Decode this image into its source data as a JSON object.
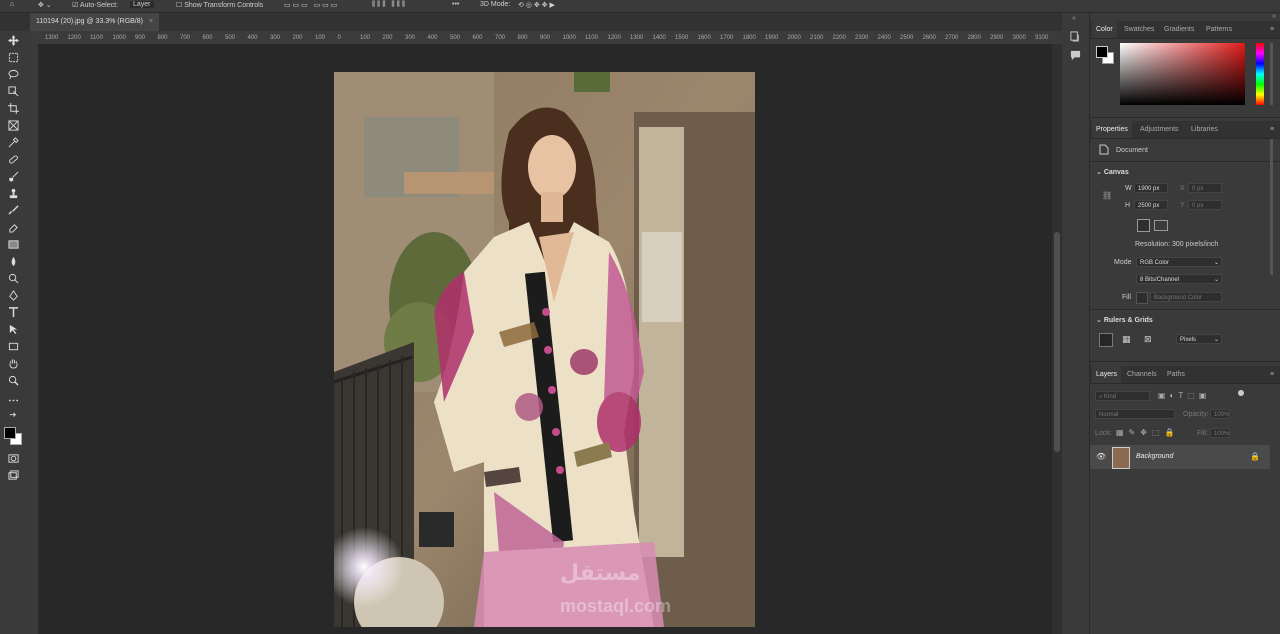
{
  "options_bar": {
    "auto_select_label": "Auto-Select:",
    "auto_select_target": "Layer",
    "transform_control_label": "Show Transform Controls",
    "mode_3d_label": "3D Mode:"
  },
  "document_tab": {
    "title": "110194 (20).jpg @ 33.3% (RGB/8)",
    "close": "×"
  },
  "ruler": {
    "ticks": [
      "1300",
      "1200",
      "1100",
      "1000",
      "900",
      "800",
      "700",
      "600",
      "500",
      "400",
      "300",
      "200",
      "100",
      "0",
      "100",
      "200",
      "300",
      "400",
      "500",
      "600",
      "700",
      "800",
      "900",
      "1000",
      "1100",
      "1200",
      "1300",
      "1400",
      "1500",
      "1600",
      "1700",
      "1800",
      "1900",
      "2000",
      "2100",
      "2200",
      "2300",
      "2400",
      "2500",
      "2600",
      "2700",
      "2800",
      "2900",
      "3000",
      "3100"
    ]
  },
  "watermark": {
    "line1": "مستقل",
    "line2": "mostaql.com"
  },
  "color_panel": {
    "tabs": [
      "Color",
      "Swatches",
      "Gradients",
      "Patterns"
    ]
  },
  "properties_panel": {
    "tabs": [
      "Properties",
      "Adjustments",
      "Libraries"
    ],
    "doc_label": "Document",
    "canvas_section": "Canvas",
    "w_label": "W",
    "w_value": "1900 px",
    "h_label": "H",
    "h_value": "2500 px",
    "x_label": "X",
    "x_value": "0 px",
    "y_label": "Y",
    "y_value": "0 px",
    "resolution": "Resolution: 300 pixels/inch",
    "mode_label": "Mode",
    "mode_value": "RGB Color",
    "depth_value": "8 Bits/Channel",
    "fill_label": "Fill",
    "fill_value": "Background Color",
    "rulers_section": "Rulers & Grids",
    "units_value": "Pixels"
  },
  "layers_panel": {
    "tabs": [
      "Layers",
      "Channels",
      "Paths"
    ],
    "kind_placeholder": "Kind",
    "blend_mode": "Normal",
    "opacity_label": "Opacity:",
    "opacity_value": "100%",
    "lock_label": "Lock:",
    "fill_label": "Fill:",
    "fill_value": "100%",
    "layer_name": "Background"
  }
}
